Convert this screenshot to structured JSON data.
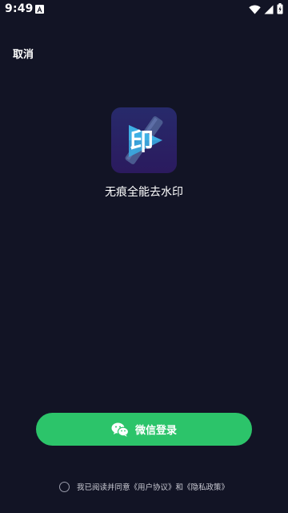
{
  "status_bar": {
    "time": "9:49",
    "icons": [
      "app-notification-icon",
      "wifi-icon",
      "signal-icon",
      "battery-icon"
    ]
  },
  "header": {
    "cancel_label": "取消"
  },
  "app": {
    "logo_text": "印",
    "name": "无痕全能去水印"
  },
  "login": {
    "wechat_label": "微信登录",
    "icon": "wechat-icon"
  },
  "agreement": {
    "prefix": "我已阅读并同意",
    "user_agreement": "《用户协议》",
    "conjunction": "和",
    "privacy_policy": "《隐私政策》",
    "checked": false
  },
  "colors": {
    "background": "#121425",
    "primary_button": "#2cc46a",
    "logo_play": "#38a8e0",
    "logo_bg": "#272a6b"
  }
}
